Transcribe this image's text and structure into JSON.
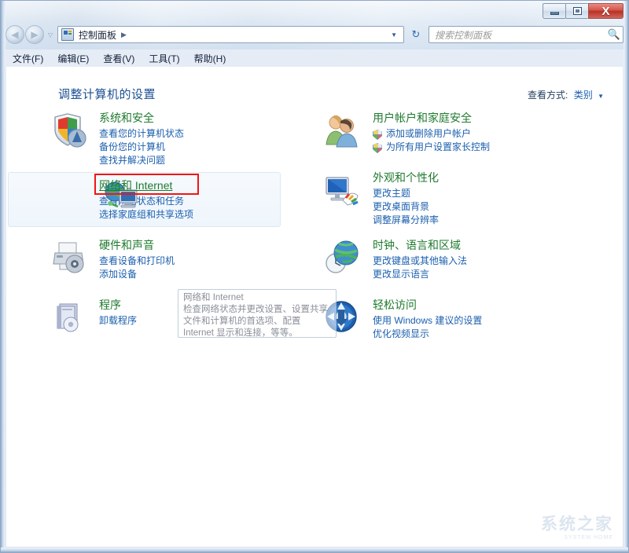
{
  "window": {
    "title": "控制面板",
    "buttons": {
      "minimize": "最小化",
      "maximize": "最大化",
      "close": "X"
    }
  },
  "nav": {
    "back": "◀",
    "forward": "▶",
    "history": "▽",
    "breadcrumb_icon": "control-panel-icon",
    "breadcrumb_root": "控制面板",
    "breadcrumb_sep": "▶",
    "address_dropdown": "▼",
    "refresh": "↻"
  },
  "search": {
    "placeholder": "搜索控制面板",
    "icon": "🔍"
  },
  "menu": {
    "items": [
      {
        "label": "文件(F)"
      },
      {
        "label": "编辑(E)"
      },
      {
        "label": "查看(V)"
      },
      {
        "label": "工具(T)"
      },
      {
        "label": "帮助(H)"
      }
    ]
  },
  "main": {
    "page_title": "调整计算机的设置",
    "view_by_label": "查看方式:",
    "view_by_value": "类别",
    "view_by_caret": "▼"
  },
  "categories": {
    "left": [
      {
        "icon": "security-shield-icon",
        "title": "系统和安全",
        "links": [
          {
            "label": "查看您的计算机状态",
            "shield": false
          },
          {
            "label": "备份您的计算机",
            "shield": false
          },
          {
            "label": "查找并解决问题",
            "shield": false
          }
        ]
      },
      {
        "icon": "network-globe-icon",
        "title": "网络和 Internet",
        "hovered": true,
        "highlighted": true,
        "links": [
          {
            "label": "查看网络状态和任务",
            "shield": false
          },
          {
            "label": "选择家庭组和共享选项",
            "shield": false
          }
        ]
      },
      {
        "icon": "printer-device-icon",
        "title": "硬件和声音",
        "links": [
          {
            "label": "查看设备和打印机",
            "shield": false
          },
          {
            "label": "添加设备",
            "shield": false
          }
        ]
      },
      {
        "icon": "programs-box-icon",
        "title": "程序",
        "links": [
          {
            "label": "卸载程序",
            "shield": false
          }
        ]
      }
    ],
    "right": [
      {
        "icon": "user-accounts-icon",
        "title": "用户帐户和家庭安全",
        "links": [
          {
            "label": "添加或删除用户帐户",
            "shield": true
          },
          {
            "label": "为所有用户设置家长控制",
            "shield": true
          }
        ]
      },
      {
        "icon": "appearance-monitor-icon",
        "title": "外观和个性化",
        "links": [
          {
            "label": "更改主题",
            "shield": false
          },
          {
            "label": "更改桌面背景",
            "shield": false
          },
          {
            "label": "调整屏幕分辨率",
            "shield": false
          }
        ]
      },
      {
        "icon": "clock-globe-icon",
        "title": "时钟、语言和区域",
        "links": [
          {
            "label": "更改键盘或其他输入法",
            "shield": false
          },
          {
            "label": "更改显示语言",
            "shield": false
          }
        ]
      },
      {
        "icon": "ease-of-access-icon",
        "title": "轻松访问",
        "links": [
          {
            "label": "使用 Windows 建议的设置",
            "shield": false
          },
          {
            "label": "优化视频显示",
            "shield": false
          }
        ]
      }
    ]
  },
  "tooltip": {
    "title": "网络和 Internet",
    "body": "检查网络状态并更改设置、设置共享文件和计算机的首选项、配置 Internet 显示和连接，等等。"
  },
  "watermark": {
    "text": "系统之家",
    "sub": "SYSTEM HOME"
  },
  "colors": {
    "category_title": "#1f7a2e",
    "link": "#1b5fae",
    "page_title": "#1b4f92",
    "highlight_box": "#f41414",
    "close_button": "#ba2f25"
  }
}
